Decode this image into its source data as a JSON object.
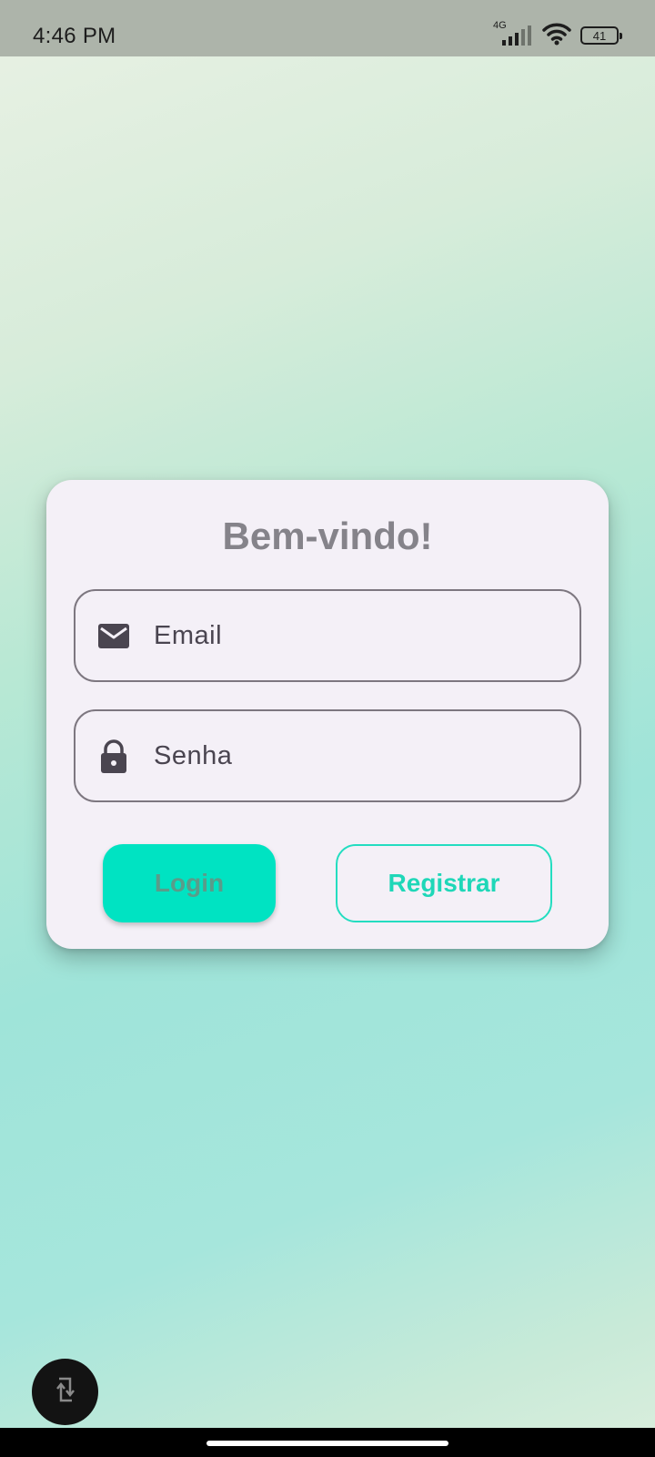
{
  "status_bar": {
    "time": "4:46 PM",
    "network_type": "4G",
    "battery_level": "41",
    "icons": [
      "signal-icon",
      "wifi-icon",
      "battery-icon"
    ]
  },
  "login_card": {
    "title": "Bem-vindo!",
    "email_field": {
      "placeholder": "Email",
      "value": "",
      "icon": "mail-icon"
    },
    "password_field": {
      "placeholder": "Senha",
      "value": "",
      "icon": "lock-icon"
    },
    "login_button_label": "Login",
    "register_button_label": "Registrar"
  },
  "floating_button": {
    "icon": "rotate-icon"
  },
  "colors": {
    "accent": "#00e3c2",
    "accent_outline": "#23ddc0",
    "card_background": "#f4f0f7",
    "title_text": "#85838a",
    "status_bar": "#adb4aa"
  }
}
